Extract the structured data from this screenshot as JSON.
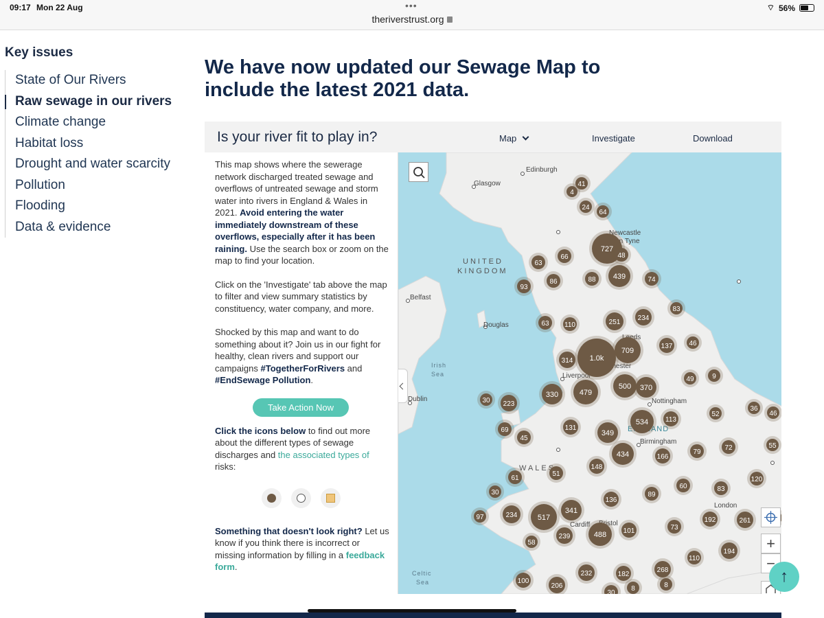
{
  "status_bar": {
    "time": "09:17",
    "date": "Mon 22 Aug",
    "url": "theriverstrust.org",
    "battery": "56%"
  },
  "sidebar": {
    "title": "Key issues",
    "items": [
      {
        "label": "State of Our Rivers",
        "active": false
      },
      {
        "label": "Raw sewage in our rivers",
        "active": true
      },
      {
        "label": "Climate change",
        "active": false
      },
      {
        "label": "Habitat loss",
        "active": false
      },
      {
        "label": "Drought and water scarcity",
        "active": false
      },
      {
        "label": "Pollution",
        "active": false
      },
      {
        "label": "Flooding",
        "active": false
      },
      {
        "label": "Data & evidence",
        "active": false
      }
    ]
  },
  "headline": "We have now updated our Sewage Map to include the latest 2021 data.",
  "card": {
    "title": "Is your river fit to play in?",
    "tabs": {
      "map": "Map",
      "investigate": "Investigate",
      "download": "Download"
    }
  },
  "info": {
    "p1_a": "This map shows where the sewerage network discharged treated sewage and overflows of untreated sewage and storm water into rivers in England & Wales in 2021. ",
    "p1_b": "Avoid entering the water immediately downstream of these overflows, especially after it has been raining.",
    "p1_c": " Use the search box or zoom on the map to find your location.",
    "p2": "Click on the 'Investigate' tab above the map to filter and view summary statistics by constituency, water company, and more.",
    "p3_a": "Shocked by this map and want to do something about it? Join us in our fight for healthy, clean rivers and support our campaigns ",
    "p3_b": "#TogetherForRivers",
    "p3_c": " and ",
    "p3_d": "#EndSewage Pollution",
    "p3_e": ".",
    "button": "Take Action Now",
    "p4_a": "Click the icons below",
    "p4_b": " to find out more about the different types of sewage discharges and ",
    "p4_c": "the associated types of",
    "p4_d": " risks:",
    "p5_a": "Something that doesn't look right?",
    "p5_b": " Let us know if you think there is incorrect or missing information by filling in a ",
    "p5_c": "feedback form",
    "p5_d": "."
  },
  "map": {
    "place_labels": [
      {
        "t": "Edinburgh"
      },
      {
        "t": "Glasgow"
      },
      {
        "t": "Newcastle"
      },
      {
        "t": "upon Tyne"
      },
      {
        "t": "UNITED"
      },
      {
        "t": "KINGDOM"
      },
      {
        "t": "Belfast"
      },
      {
        "t": "Douglas"
      },
      {
        "t": "Leeds"
      },
      {
        "t": "Manchester"
      },
      {
        "t": "Liverpool"
      },
      {
        "t": "Irish"
      },
      {
        "t": "Sea"
      },
      {
        "t": "Dublin"
      },
      {
        "t": "Nottingham"
      },
      {
        "t": "ENGLAND"
      },
      {
        "t": "Birmingham"
      },
      {
        "t": "WALES"
      },
      {
        "t": "London"
      },
      {
        "t": "Cardiff"
      },
      {
        "t": "Bristol"
      },
      {
        "t": "Celtic"
      },
      {
        "t": "Sea"
      }
    ],
    "clusters": [
      "41",
      "4",
      "24",
      "64",
      "727",
      "48",
      "66",
      "63",
      "88",
      "439",
      "74",
      "93",
      "86",
      "83",
      "63",
      "110",
      "251",
      "234",
      "709",
      "1.0k",
      "137",
      "46",
      "314",
      "49",
      "9",
      "500",
      "370",
      "330",
      "479",
      "30",
      "223",
      "52",
      "36",
      "46",
      "534",
      "113",
      "69",
      "45",
      "131",
      "349",
      "72",
      "55",
      "434",
      "166",
      "79",
      "148",
      "61",
      "51",
      "120",
      "30",
      "60",
      "83",
      "136",
      "89",
      "97",
      "234",
      "517",
      "341",
      "192",
      "261",
      "48",
      "239",
      "488",
      "101",
      "73",
      "58",
      "110",
      "194",
      "232",
      "182",
      "268",
      "100",
      "206",
      "30",
      "8",
      "8"
    ],
    "controls": {
      "plus": "+",
      "minus": "−"
    }
  },
  "fab": "↑"
}
